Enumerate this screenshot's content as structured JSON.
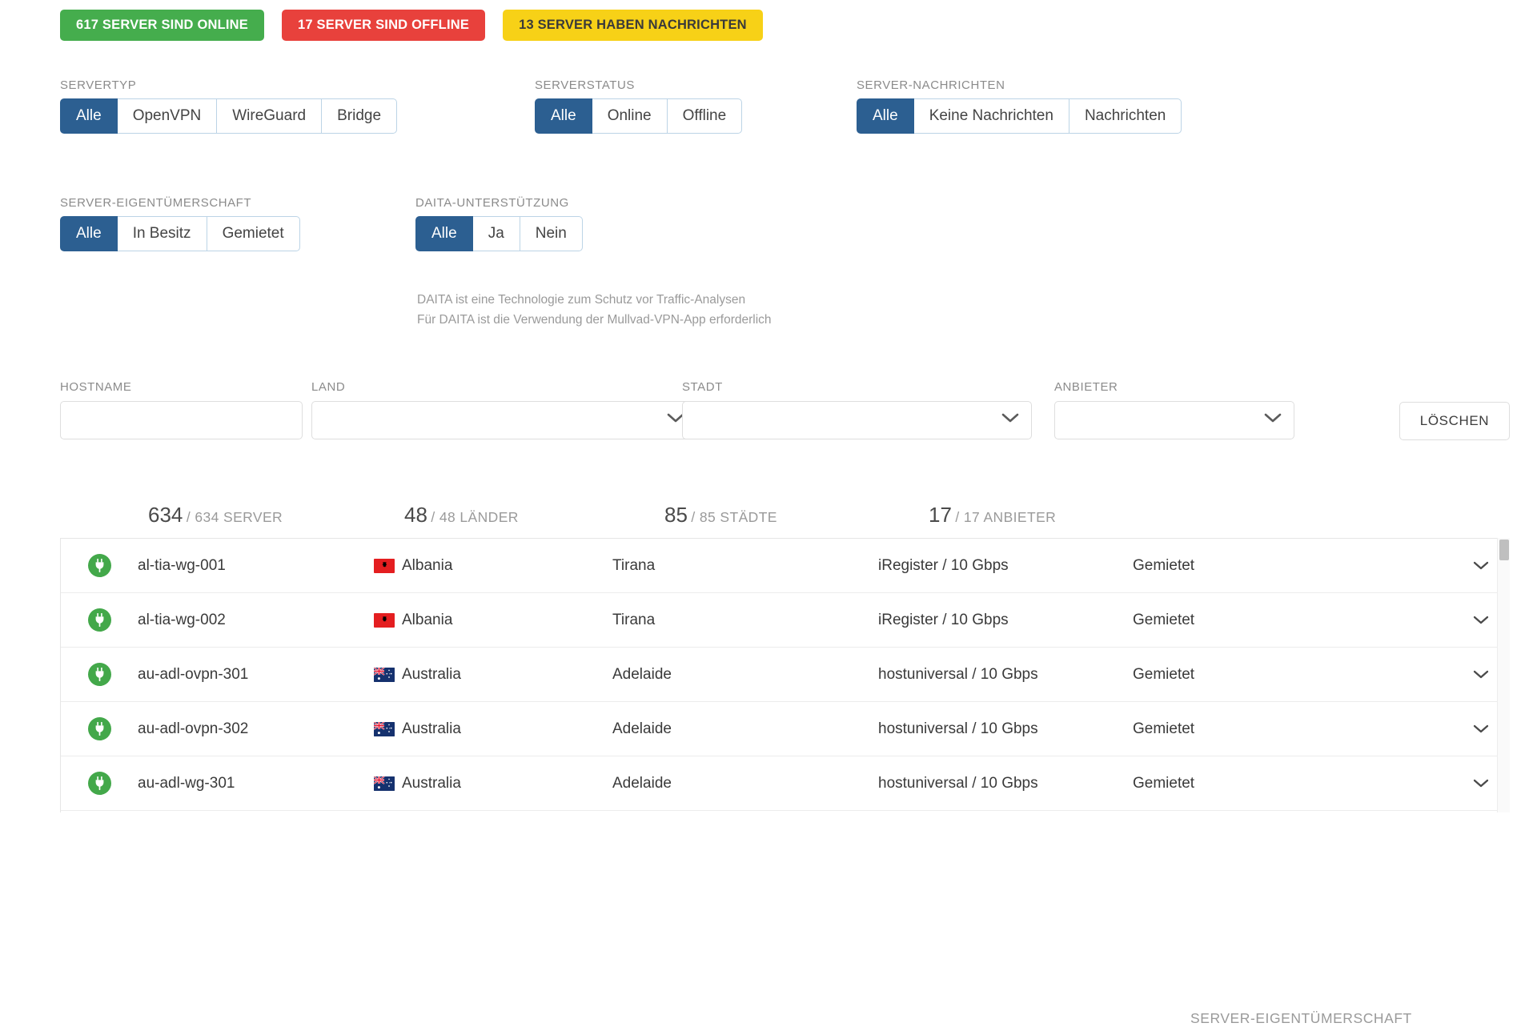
{
  "badges": [
    {
      "label": "617 SERVER SIND ONLINE",
      "color": "#45ad4d",
      "name": "badge-online"
    },
    {
      "label": "17 SERVER SIND OFFLINE",
      "color": "#e8413c",
      "name": "badge-offline"
    },
    {
      "label": "13 SERVER HABEN NACHRICHTEN",
      "color": "#f7d117",
      "name": "badge-messages"
    }
  ],
  "filters": {
    "servertype": {
      "label": "SERVERTYP",
      "options": [
        "Alle",
        "OpenVPN",
        "WireGuard",
        "Bridge"
      ],
      "selected": "Alle"
    },
    "serverstatus": {
      "label": "SERVERSTATUS",
      "options": [
        "Alle",
        "Online",
        "Offline"
      ],
      "selected": "Alle"
    },
    "messages": {
      "label": "SERVER-NACHRICHTEN",
      "options": [
        "Alle",
        "Keine Nachrichten",
        "Nachrichten"
      ],
      "selected": "Alle"
    },
    "ownership": {
      "label": "SERVER-EIGENTÜMERSCHAFT",
      "options": [
        "Alle",
        "In Besitz",
        "Gemietet"
      ],
      "selected": "Alle"
    },
    "daita": {
      "label": "DAITA-UNTERSTÜTZUNG",
      "options": [
        "Alle",
        "Ja",
        "Nein"
      ],
      "selected": "Alle"
    }
  },
  "daita_note": {
    "line1": "DAITA ist eine Technologie zum Schutz vor Traffic-Analysen",
    "line2": "Für DAITA ist die Verwendung der Mullvad-VPN-App erforderlich"
  },
  "search": {
    "hostname": {
      "label": "HOSTNAME",
      "value": "",
      "placeholder": ""
    },
    "land": {
      "label": "LAND",
      "value": ""
    },
    "stadt": {
      "label": "STADT",
      "value": ""
    },
    "anbieter": {
      "label": "ANBIETER",
      "value": ""
    },
    "clear_label": "LÖSCHEN"
  },
  "stats": {
    "server": {
      "count": "634",
      "total": "/ 634 SERVER"
    },
    "laender": {
      "count": "48",
      "total": "/ 48 LÄNDER"
    },
    "staedte": {
      "count": "85",
      "total": "/ 85 STÄDTE"
    },
    "anbieter": {
      "count": "17",
      "total": "/ 17 ANBIETER"
    },
    "ownership_header": "SERVER-EIGENTÜMERSCHAFT"
  },
  "table": {
    "rows": [
      {
        "status": "online",
        "hostname": "al-tia-wg-001",
        "country": "Albania",
        "flag": "al",
        "city": "Tirana",
        "provider": "iRegister / 10 Gbps",
        "ownership": "Gemietet"
      },
      {
        "status": "online",
        "hostname": "al-tia-wg-002",
        "country": "Albania",
        "flag": "al",
        "city": "Tirana",
        "provider": "iRegister / 10 Gbps",
        "ownership": "Gemietet"
      },
      {
        "status": "online",
        "hostname": "au-adl-ovpn-301",
        "country": "Australia",
        "flag": "au",
        "city": "Adelaide",
        "provider": "hostuniversal / 10 Gbps",
        "ownership": "Gemietet"
      },
      {
        "status": "online",
        "hostname": "au-adl-ovpn-302",
        "country": "Australia",
        "flag": "au",
        "city": "Adelaide",
        "provider": "hostuniversal / 10 Gbps",
        "ownership": "Gemietet"
      },
      {
        "status": "online",
        "hostname": "au-adl-wg-301",
        "country": "Australia",
        "flag": "au",
        "city": "Adelaide",
        "provider": "hostuniversal / 10 Gbps",
        "ownership": "Gemietet"
      }
    ]
  },
  "colors": {
    "accent_blue": "#2c5f91",
    "online_green": "#43a84a",
    "badge_green": "#45ad4d",
    "badge_red": "#e8413c",
    "badge_yellow": "#f7d117"
  }
}
